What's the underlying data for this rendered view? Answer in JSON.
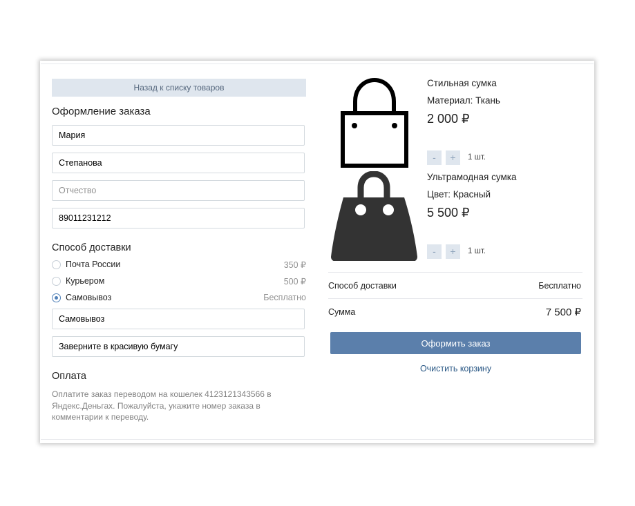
{
  "left": {
    "back_label": "Назад к списку товаров",
    "order_title": "Оформление заказа",
    "fields": {
      "first_name": "Мария",
      "last_name": "Степанова",
      "patronymic_placeholder": "Отчество",
      "phone": "89011231212"
    },
    "delivery_title": "Способ доставки",
    "delivery_options": [
      {
        "label": "Почта России",
        "price": "350 ₽",
        "selected": false
      },
      {
        "label": "Курьером",
        "price": "500 ₽",
        "selected": false
      },
      {
        "label": "Самовывоз",
        "price": "Бесплатно",
        "selected": true
      }
    ],
    "pickup_value": "Самовывоз",
    "comment_value": "Заверните в красивую бумагу",
    "payment_title": "Оплата",
    "payment_text": "Оплатите заказ переводом на кошелек 4123121343566 в Яндекс.Деньгах. Пожалуйста, укажите номер заказа в комментарии к переводу."
  },
  "cart": {
    "items": [
      {
        "name": "Стильная сумка",
        "attr": "Материал: Ткань",
        "price": "2 000 ₽",
        "minus": "-",
        "plus": "+",
        "qty": "1 шт.",
        "icon": "outline-bag-icon"
      },
      {
        "name": "Ультрамодная сумка",
        "attr": "Цвет: Красный",
        "price": "5 500 ₽",
        "minus": "-",
        "plus": "+",
        "qty": "1 шт.",
        "icon": "filled-handbag-icon"
      }
    ],
    "delivery_label": "Способ доставки",
    "delivery_value": "Бесплатно",
    "total_label": "Сумма",
    "total_value": "7 500 ₽",
    "order_button": "Оформить заказ",
    "clear_link": "Очистить корзину"
  },
  "colors": {
    "accent": "#5b7fab",
    "link": "#2a5885",
    "secondary_button_bg": "#dfe6ee"
  }
}
